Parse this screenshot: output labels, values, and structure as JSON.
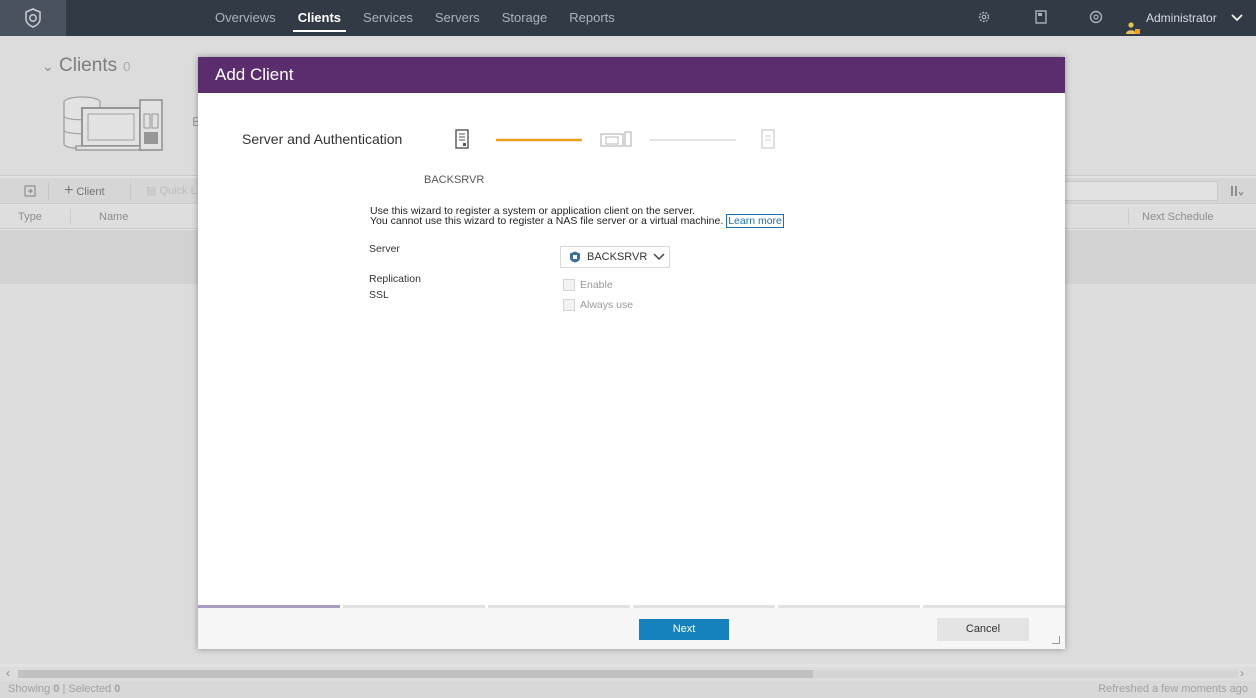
{
  "nav": {
    "items": [
      {
        "label": "Overviews"
      },
      {
        "label": "Clients"
      },
      {
        "label": "Services"
      },
      {
        "label": "Servers"
      },
      {
        "label": "Storage"
      },
      {
        "label": "Reports"
      }
    ],
    "active": "Clients",
    "user": "Administrator"
  },
  "page": {
    "title": "Clients",
    "count": "0",
    "toolbar": {
      "add_client": "Client",
      "quick_look": "Quick L"
    },
    "columns": {
      "type": "Type",
      "name": "Name",
      "next_schedule": "Next Schedule"
    },
    "footer": {
      "showing_label": "Showing",
      "showing_value": "0",
      "selected_label": "Selected",
      "selected_value": "0",
      "separator": "|",
      "refreshed": "Refreshed a few moments ago"
    }
  },
  "modal": {
    "title": "Add Client",
    "step_title": "Server and Authentication",
    "server_header": "BACKSRVR",
    "description_line1": "Use this wizard to register a system or application client on the server.",
    "description_line2": "You cannot use this wizard to register a NAS file server or a virtual machine.",
    "learn_more": "Learn more",
    "labels": {
      "server": "Server",
      "replication": "Replication",
      "ssl": "SSL"
    },
    "server_select_value": "BACKSRVR",
    "replication_option": "Enable",
    "ssl_option": "Always use",
    "next_button": "Next",
    "cancel_button": "Cancel",
    "progress_steps_total": 6,
    "progress_current_step": 1
  },
  "colors": {
    "modal_header": "#5c2d6e",
    "wizard_active": "#f0a020",
    "primary_button": "#1582bd",
    "topbar": "#323a45",
    "progress_active": "#a99cc0"
  }
}
